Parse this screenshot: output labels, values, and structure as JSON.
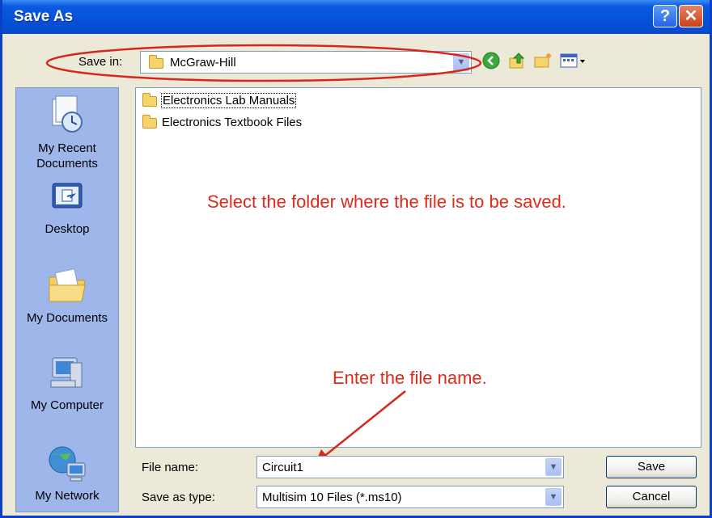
{
  "window": {
    "title": "Save As",
    "help_label": "?",
    "close_label": "✕"
  },
  "toolbar": {
    "save_in_label": "Save in:",
    "save_in_value": "McGraw-Hill"
  },
  "places": [
    {
      "label": "My Recent\nDocuments",
      "icon": "recent-documents-icon"
    },
    {
      "label": "Desktop",
      "icon": "desktop-icon"
    },
    {
      "label": "My Documents",
      "icon": "my-documents-icon"
    },
    {
      "label": "My Computer",
      "icon": "my-computer-icon"
    },
    {
      "label": "My Network",
      "icon": "my-network-icon"
    }
  ],
  "files": [
    {
      "name": "Electronics Lab Manuals"
    },
    {
      "name": "Electronics Textbook Files"
    }
  ],
  "annotations": {
    "select_folder": "Select the folder where the file is to be saved.",
    "enter_name": "Enter the file name."
  },
  "form": {
    "file_name_label": "File name:",
    "file_name_value": "Circuit1",
    "save_type_label": "Save as type:",
    "save_type_value": "Multisim 10 Files (*.ms10)",
    "save_button": "Save",
    "cancel_button": "Cancel"
  },
  "colors": {
    "title_bar": "#0551D8",
    "annotation": "#E0291A",
    "places_bg": "#9EB6E9",
    "dialog_bg": "#ECE9D8"
  }
}
